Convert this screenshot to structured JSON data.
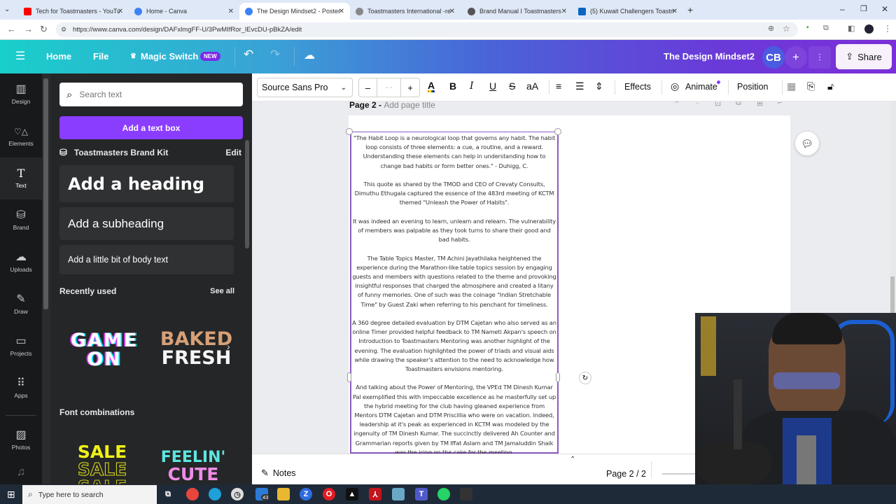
{
  "browser": {
    "tabs": [
      {
        "label": "Tech for Toastmasters - YouTu",
        "icon": "youtube-icon",
        "color": "#ff0000",
        "active": false
      },
      {
        "label": "Home - Canva",
        "icon": "canva-icon",
        "color": "#3b82f6",
        "active": false
      },
      {
        "label": "The Design Mindset2 - Poster",
        "icon": "canva-icon",
        "color": "#3b82f6",
        "active": true
      },
      {
        "label": "Toastmasters International -re",
        "icon": "globe-icon",
        "color": "#777777",
        "active": false
      },
      {
        "label": "Brand Manual I Toastmasters I",
        "icon": "globe-icon",
        "color": "#555555",
        "active": false
      },
      {
        "label": "(5) Kuwait Challengers Toastm",
        "icon": "linkedin-icon",
        "color": "#0a66c2",
        "active": false
      }
    ],
    "new_tab": "+",
    "url": "https://www.canva.com/design/DAFxlmgFF-U/3PwMIfRor_lEvcDU-pBkZA/edit"
  },
  "header": {
    "menu_icon": "☰",
    "home": "Home",
    "file": "File",
    "magic_switch": "Magic Switch",
    "magic_badge": "NEW",
    "design_title": "The Design Mindset2",
    "avatar": "CB",
    "add": "+",
    "share": "Share"
  },
  "rail": [
    {
      "label": "Design",
      "icon": "▥"
    },
    {
      "label": "Elements",
      "icon": "♡△"
    },
    {
      "label": "Text",
      "icon": "T",
      "active": true
    },
    {
      "label": "Brand",
      "icon": "⛁"
    },
    {
      "label": "Uploads",
      "icon": "☁"
    },
    {
      "label": "Draw",
      "icon": "✎"
    },
    {
      "label": "Projects",
      "icon": "▭"
    },
    {
      "label": "Apps",
      "icon": "⠿"
    },
    {
      "label": "Photos",
      "icon": "▨"
    },
    {
      "label": "",
      "icon": "♫"
    }
  ],
  "panel": {
    "search_placeholder": "Search text",
    "add_textbox": "Add a text box",
    "brand_kit": "Toastmasters Brand Kit",
    "brand_edit": "Edit",
    "heading": "Add a heading",
    "subheading": "Add a subheading",
    "body": "Add a little bit of body text",
    "recent_title": "Recently used",
    "see_all": "See all",
    "recent": [
      {
        "line1": "GAME",
        "line2": "ON"
      },
      {
        "line1": "BAKED",
        "line2": "FRESH"
      }
    ],
    "combos_title": "Font combinations",
    "combos": [
      {
        "line1": "SALE",
        "line2": "SALE",
        "line3": "SALE"
      },
      {
        "line1": "FEELIN'",
        "line2": "CUTE"
      }
    ]
  },
  "toolbar": {
    "font": "Source Sans Pro",
    "size_minus": "–",
    "size_value": "- -",
    "size_plus": "+",
    "effects": "Effects",
    "animate": "Animate",
    "position": "Position"
  },
  "canvas": {
    "page_label": "Page 2 -",
    "page_title_placeholder": "Add page title",
    "paragraphs": [
      "\"The Habit Loop is a neurological loop that governs any habit. The habit loop consists of three elements: a cue, a routine, and a reward. Understanding these elements can help in understanding how to change bad habits or form better ones.\" - Duhigg, C.",
      "This quote as shared by the TMOD and CEO of Crevaty Consults, Dimuthu Ethugala captured the essence of the 483rd meeting of KCTM themed \"Unleash the Power of Habits\".",
      "It was indeed an evening to learn, unlearn and relearn. The vulnerability of members was palpable as they took turns to share their good and bad habits.",
      "The Table Topics Master, TM Achini Jayathilaka heightened the experience during the Marathon-like table topics session by engaging guests and members with questions related to the theme and provoking insightful responses that charged the atmosphere and created a litany of funny memories. One of such was the coinage \"Indian Stretchable Time\" by Guest Zaki when referring to his penchant for timeliness.",
      "A 360 degree detailed evaluation by DTM Cajetan who also served as an online Timer provided helpful feedback to TM Nameti Akpan's speech on Introduction to Toastmasters Mentoring was another highlight of the evening. The evaluation highlighted the power of triads and visual aids while drawing the speaker's attention to the need to acknowledge how Toastmasters envisions mentoring.",
      "And talking about the Power of Mentoring, the VPEd TM Dinesh Kumar Pal exemplified this with impeccable excellence as he masterfully set up the hybrid meeting for the club having gleaned experience from Mentors DTM Cajetan and DTM Priscillia who were on vacation. Indeed, leadership at it's peak as experienced in KCTM was modeled by the ingenuity of TM Dinesh Kumar. The succinctly delivered Ah Counter and Grammarian reports given by TM Iffat Aslam and TM Jamaluddin Shaik was the icing on the cake for the meeting."
    ]
  },
  "bottom": {
    "notes": "Notes",
    "page_count": "Page 2 / 2"
  },
  "taskbar": {
    "search_placeholder": "Type here to search",
    "badge": "43"
  }
}
